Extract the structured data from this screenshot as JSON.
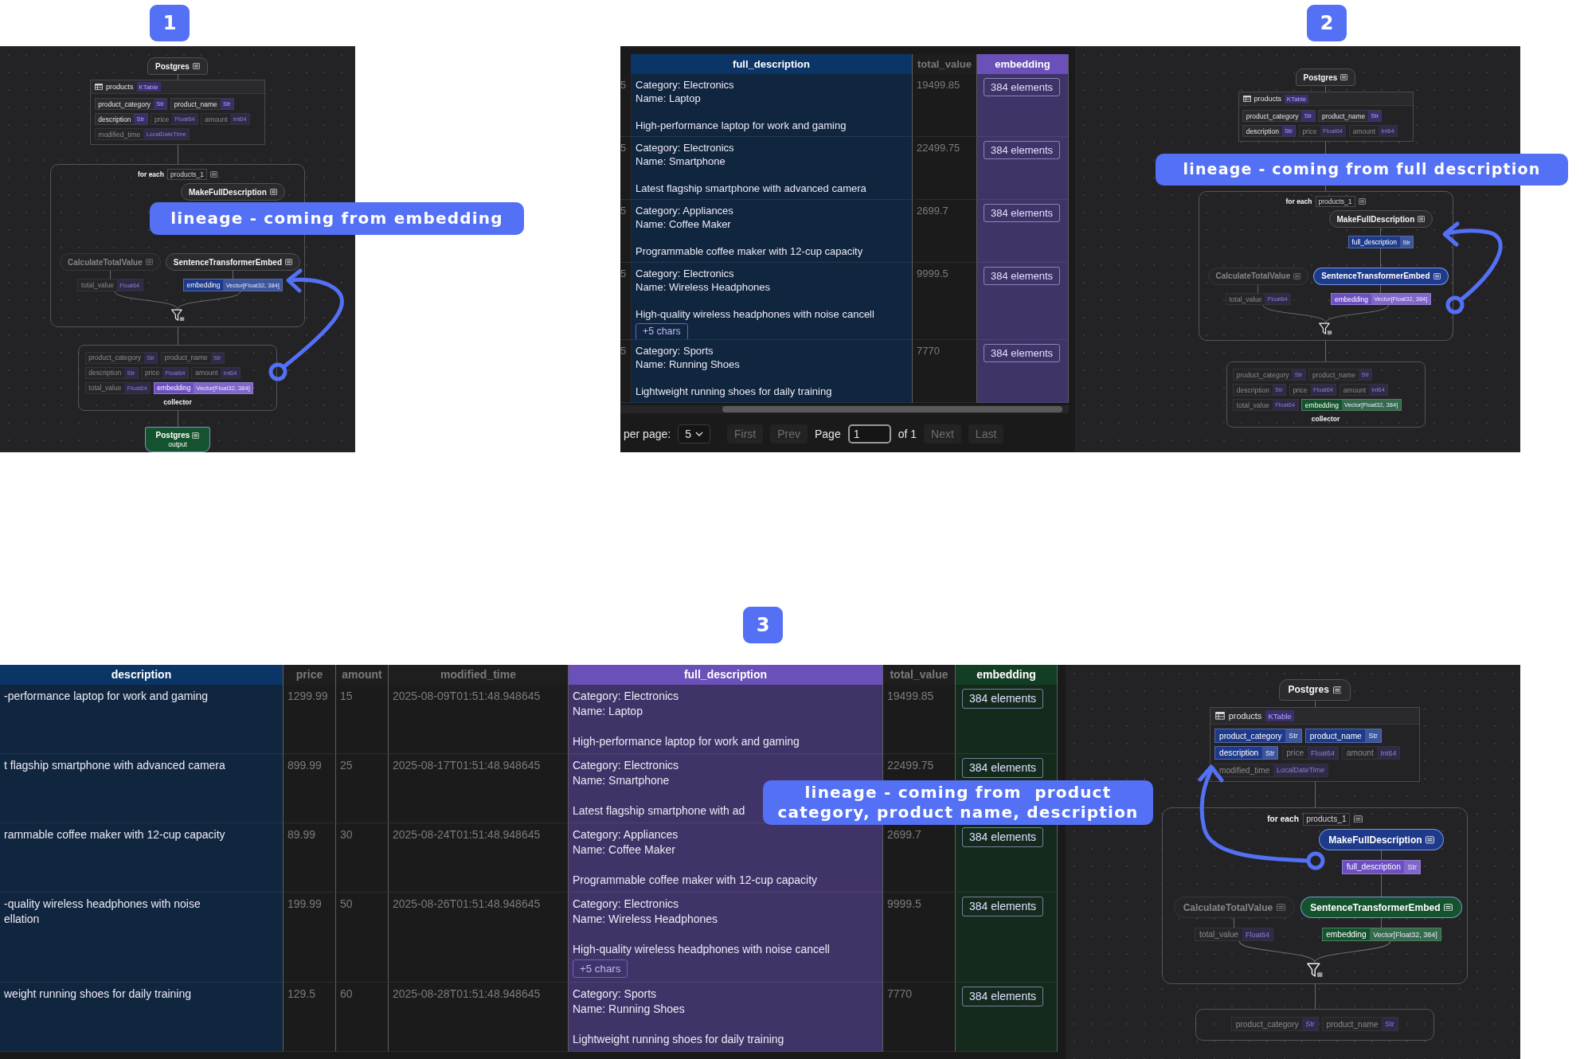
{
  "panels": [
    {
      "badge": "1",
      "callout": "lineage - coming from embedding",
      "graph": {
        "source": {
          "label": "Postgres",
          "dimmed": false
        },
        "table": {
          "name": "products",
          "type": "KTable",
          "fields": [
            {
              "name": "product_category",
              "type": "Str",
              "dimmed": false
            },
            {
              "name": "product_name",
              "type": "Str",
              "dimmed": false
            },
            {
              "name": "description",
              "type": "Str",
              "dimmed": false
            },
            {
              "name": "price",
              "type": "Float64",
              "dimmed": true
            },
            {
              "name": "amount",
              "type": "Int64",
              "dimmed": true
            },
            {
              "name": "modified_time",
              "type": "LocalDateTime",
              "dimmed": true
            }
          ]
        },
        "foreach": {
          "label": "for each",
          "scope": "products_1",
          "transform": {
            "label": "MakeFullDescription",
            "dimmed": false
          },
          "branches": [
            {
              "label": "CalculateTotalValue",
              "dimmed": true,
              "output": {
                "name": "total_value",
                "type": "Float64",
                "dimmed": true
              }
            },
            {
              "label": "SentenceTransformerEmbed",
              "dimmed": false,
              "output": {
                "name": "embedding",
                "type": "Vector[Float32, 384]",
                "color": "#1e3a8a"
              }
            }
          ]
        },
        "collector": {
          "label": "collector",
          "fields": [
            {
              "name": "product_category",
              "type": "Str",
              "dimmed": true
            },
            {
              "name": "product_name",
              "type": "Str",
              "dimmed": true
            },
            {
              "name": "description",
              "type": "Str",
              "dimmed": true
            },
            {
              "name": "price",
              "type": "Float64",
              "dimmed": true
            },
            {
              "name": "amount",
              "type": "Int64",
              "dimmed": true
            },
            {
              "name": "total_value",
              "type": "Float64",
              "dimmed": true
            },
            {
              "name": "embedding",
              "type": "Vector[Float32, 384]",
              "color": "#6d4fc2"
            }
          ]
        },
        "target": {
          "label": "Postgres",
          "sublabel": "output",
          "color": "#14532d"
        }
      }
    },
    {
      "badge": "2",
      "callout": "lineage - coming from full description",
      "table": {
        "columns": [
          {
            "label": "full_description",
            "color": "#0b3566",
            "kind": "rich"
          },
          {
            "label": "total_value",
            "kind": "number"
          },
          {
            "label": "embedding",
            "color": "#6a50b8",
            "kind": "button"
          }
        ],
        "rows": [
          {
            "cells": [
              {
                "prefix": "5",
                "lines": [
                  "Category: Electronics",
                  "Name: Laptop"
                ],
                "body": "High-performance laptop for work and gaming"
              },
              "19499.85",
              "384 elements"
            ]
          },
          {
            "cells": [
              {
                "prefix": "5",
                "lines": [
                  "Category: Electronics",
                  "Name: Smartphone"
                ],
                "body": "Latest flagship smartphone with advanced camera"
              },
              "22499.75",
              "384 elements"
            ]
          },
          {
            "cells": [
              {
                "prefix": "5",
                "lines": [
                  "Category: Appliances",
                  "Name: Coffee Maker"
                ],
                "body": "Programmable coffee maker with 12-cup capacity"
              },
              "2699.7",
              "384 elements"
            ]
          },
          {
            "cells": [
              {
                "prefix": "5",
                "lines": [
                  "Category: Electronics",
                  "Name: Wireless Headphones"
                ],
                "body": "High-quality wireless headphones with noise cancell",
                "more": "+5 chars"
              },
              "9999.5",
              "384 elements"
            ]
          },
          {
            "cells": [
              {
                "prefix": "5",
                "lines": [
                  "Category: Sports",
                  "Name: Running Shoes"
                ],
                "body": "Lightweight running shoes for daily training"
              },
              "7770",
              "384 elements"
            ]
          }
        ]
      },
      "pagination": {
        "label": "per page:",
        "page_size": "5",
        "before": [
          {
            "label": "First",
            "disabled": true
          },
          {
            "label": "Prev",
            "disabled": true
          }
        ],
        "page_label": "Page",
        "page": "1",
        "total": "of 1",
        "after": [
          {
            "label": "Next",
            "disabled": true
          },
          {
            "label": "Last",
            "disabled": true
          }
        ]
      },
      "graph": {
        "source": {
          "label": "Postgres",
          "dimmed": false
        },
        "table": {
          "name": "products",
          "type": "KTable",
          "fields": [
            {
              "name": "product_category",
              "type": "Str",
              "dimmed": false
            },
            {
              "name": "product_name",
              "type": "Str",
              "dimmed": false
            },
            {
              "name": "description",
              "type": "Str",
              "dimmed": false
            },
            {
              "name": "price",
              "type": "Float64",
              "dimmed": true
            },
            {
              "name": "amount",
              "type": "Int64",
              "dimmed": true
            }
          ]
        },
        "foreach": {
          "label": "for each",
          "scope": "products_1",
          "transform": {
            "label": "MakeFullDescription",
            "dimmed": false,
            "outputs": [
              {
                "name": "full_description",
                "type": "Str",
                "color": "#1e3a8a"
              }
            ]
          },
          "branches": [
            {
              "label": "CalculateTotalValue",
              "dimmed": true,
              "output": {
                "name": "total_value",
                "type": "Float64",
                "dimmed": true
              }
            },
            {
              "label": "SentenceTransformerEmbed",
              "color": "#1e3a8a",
              "output": {
                "name": "embedding",
                "type": "Vector[Float32, 384]",
                "color": "#6d4fc2"
              }
            }
          ]
        },
        "collector": {
          "label": "collector",
          "fields": [
            {
              "name": "product_category",
              "type": "Str",
              "dimmed": true
            },
            {
              "name": "product_name",
              "type": "Str",
              "dimmed": true
            },
            {
              "name": "description",
              "type": "Str",
              "dimmed": true
            },
            {
              "name": "price",
              "type": "Float64",
              "dimmed": true
            },
            {
              "name": "amount",
              "type": "Int64",
              "dimmed": true
            },
            {
              "name": "total_value",
              "type": "Float64",
              "dimmed": true
            },
            {
              "name": "embedding",
              "type": "Vector[Float32, 384]",
              "color": "#14532d"
            }
          ]
        }
      }
    },
    {
      "badge": "3",
      "callout": "lineage - coming from  product category, product name, description",
      "table": {
        "columns": [
          {
            "label": "description",
            "color": "#0b3566",
            "kind": "text"
          },
          {
            "label": "price",
            "kind": "number"
          },
          {
            "label": "amount",
            "kind": "number"
          },
          {
            "label": "modified_time",
            "kind": "number"
          },
          {
            "label": "full_description",
            "color": "#6a50b8",
            "kind": "rich"
          },
          {
            "label": "total_value",
            "kind": "number"
          },
          {
            "label": "embedding",
            "color": "#123f24",
            "kind": "button"
          }
        ],
        "rows": [
          {
            "cells": [
              {
                "lines": [
                  "-performance laptop for work and gaming"
                ]
              },
              "1299.99",
              "15",
              "2025-08-09T01:51:48.948645",
              {
                "lines": [
                  "Category: Electronics",
                  "Name: Laptop"
                ],
                "body": "High-performance laptop for work and gaming"
              },
              "19499.85",
              "384 elements"
            ]
          },
          {
            "cells": [
              {
                "lines": [
                  "t flagship smartphone with advanced camera"
                ]
              },
              "899.99",
              "25",
              "2025-08-17T01:51:48.948645",
              {
                "lines": [
                  "Category: Electronics",
                  "Name: Smartphone"
                ],
                "body": "Latest flagship smartphone with ad"
              },
              "22499.75",
              "384 elements"
            ]
          },
          {
            "cells": [
              {
                "lines": [
                  "rammable coffee maker with 12-cup capacity"
                ]
              },
              "89.99",
              "30",
              "2025-08-24T01:51:48.948645",
              {
                "lines": [
                  "Category: Appliances",
                  "Name: Coffee Maker"
                ],
                "body": "Programmable coffee maker with 12-cup capacity"
              },
              "2699.7",
              "384 elements"
            ]
          },
          {
            "cells": [
              {
                "lines": [
                  "-quality wireless headphones with noise",
                  "ellation"
                ]
              },
              "199.99",
              "50",
              "2025-08-26T01:51:48.948645",
              {
                "lines": [
                  "Category: Electronics",
                  "Name: Wireless Headphones"
                ],
                "body": "High-quality wireless headphones with noise cancell",
                "more": "+5 chars"
              },
              "9999.5",
              "384 elements"
            ]
          },
          {
            "cells": [
              {
                "lines": [
                  "weight running shoes for daily training"
                ]
              },
              "129.5",
              "60",
              "2025-08-28T01:51:48.948645",
              {
                "lines": [
                  "Category: Sports",
                  "Name: Running Shoes"
                ],
                "body": "Lightweight running shoes for daily training"
              },
              "7770",
              "384 elements"
            ]
          }
        ]
      },
      "graph": {
        "source": {
          "label": "Postgres",
          "dimmed": false
        },
        "table": {
          "name": "products",
          "type": "KTable",
          "fields": [
            {
              "name": "product_category",
              "type": "Str",
              "color": "#1e3a8a"
            },
            {
              "name": "product_name",
              "type": "Str",
              "color": "#1e3a8a"
            },
            {
              "name": "description",
              "type": "Str",
              "color": "#1e3a8a"
            },
            {
              "name": "price",
              "type": "Float64",
              "dimmed": true
            },
            {
              "name": "amount",
              "type": "Int64",
              "dimmed": true
            },
            {
              "name": "modified_time",
              "type": "LocalDateTime",
              "dimmed": true
            }
          ]
        },
        "foreach": {
          "label": "for each",
          "scope": "products_1",
          "transform": {
            "label": "MakeFullDescription",
            "color": "#1e3a8a",
            "outputs": [
              {
                "name": "full_description",
                "type": "Str",
                "color": "#6d4fc2"
              }
            ]
          },
          "branches": [
            {
              "label": "CalculateTotalValue",
              "dimmed": true,
              "output": {
                "name": "total_value",
                "type": "Float64",
                "dimmed": true
              }
            },
            {
              "label": "SentenceTransformerEmbed",
              "color": "#14532d",
              "output": {
                "name": "embedding",
                "type": "Vector[Float32, 384]",
                "color": "#14532d"
              }
            }
          ]
        },
        "collector": {
          "fields": [
            {
              "name": "product_category",
              "type": "Str",
              "dimmed": true
            },
            {
              "name": "product_name",
              "type": "Str",
              "dimmed": true
            }
          ]
        }
      }
    }
  ]
}
